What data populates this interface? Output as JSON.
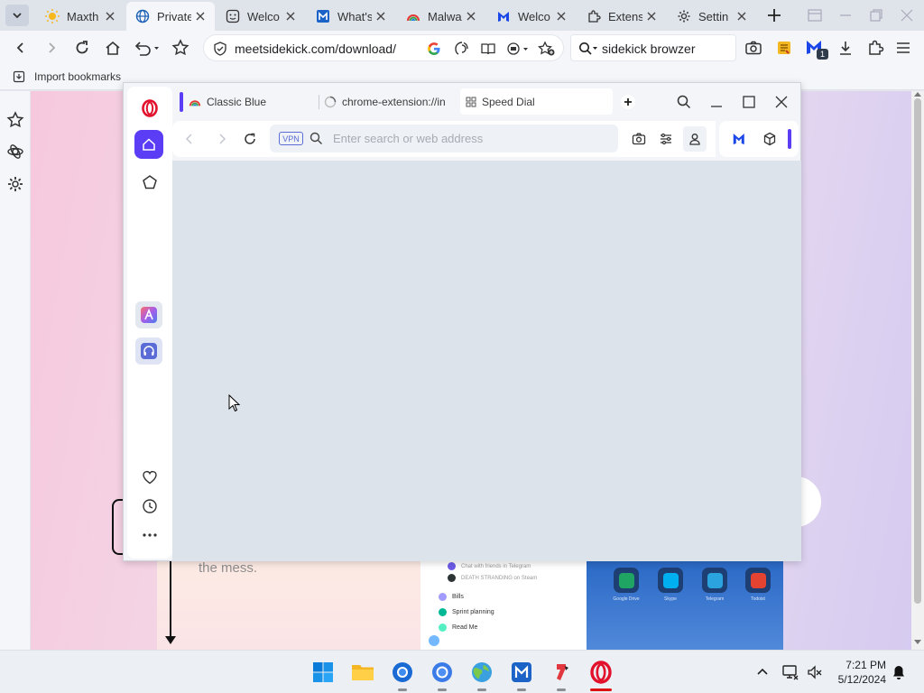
{
  "browser": {
    "tabs": [
      {
        "label": "Maxth",
        "icon": "sun-icon",
        "active": false
      },
      {
        "label": "Private",
        "icon": "globe-icon",
        "active": true
      },
      {
        "label": "Welco",
        "icon": "smiley-icon",
        "active": false
      },
      {
        "label": "What's",
        "icon": "maxthon-m-icon",
        "active": false
      },
      {
        "label": "Malwa",
        "icon": "rainbow-icon",
        "active": false
      },
      {
        "label": "Welco",
        "icon": "malwarebytes-icon",
        "active": false
      },
      {
        "label": "Extensi",
        "icon": "puzzle-icon",
        "active": false
      },
      {
        "label": "Settin",
        "icon": "gear-icon",
        "active": false
      }
    ],
    "url": "meetsidekick.com/download/",
    "search_query": "sidekick browzer",
    "extension_badge": "1",
    "bookmarks": [
      {
        "label": "Import bookmarks"
      }
    ]
  },
  "page": {
    "tagline": "the mess.",
    "list_items": [
      {
        "label": "Chat with friends in Telegram",
        "muted": true
      },
      {
        "label": "DEATH STRANDING on Steam",
        "muted": true
      },
      {
        "label": "Bills",
        "muted": false
      },
      {
        "label": "Sprint planning",
        "muted": false
      },
      {
        "label": "Read Me",
        "muted": false
      }
    ],
    "apps": [
      {
        "label": "Google Drive",
        "color": "#1fa463"
      },
      {
        "label": "Skype",
        "color": "#00aff0"
      },
      {
        "label": "Telegram",
        "color": "#2aa3df"
      },
      {
        "label": "Todoist",
        "color": "#e44332"
      }
    ]
  },
  "opera": {
    "tabs": [
      {
        "label": "Classic Blue",
        "icon": "rainbow-icon",
        "active": false
      },
      {
        "label": "chrome-extension://in",
        "icon": "loading-icon",
        "active": false
      },
      {
        "label": "Speed Dial",
        "icon": "speed-dial-icon",
        "active": true
      }
    ],
    "vpn_label": "VPN",
    "address_placeholder": "Enter search or web address"
  },
  "taskbar": {
    "time": "7:21 PM",
    "date": "5/12/2024"
  },
  "colors": {
    "opera_accent": "#5b3df5",
    "opera_red": "#e2112c",
    "page_bg": "#dce3ea"
  }
}
